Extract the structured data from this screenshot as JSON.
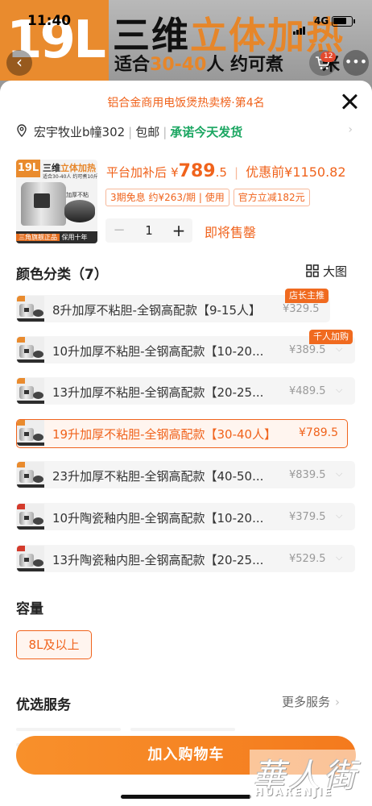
{
  "status_bar": {
    "time": "11:40",
    "network": "4G"
  },
  "background": {
    "badge": "19L",
    "title_black": "三维",
    "title_orange": "立体加热",
    "sub_pre": "适合",
    "sub_orange": "30-40",
    "sub_post": "人 约可煮",
    "sub_tail": "米",
    "cart_count": "12"
  },
  "sheet": {
    "rank": "铝合金商用电饭煲热卖榜·第4名",
    "address": "宏宇牧业b幢302",
    "shipping": "包邮",
    "promise": "承诺今天发货"
  },
  "product": {
    "thumb_badge": "19L",
    "thumb_title_black": "三维",
    "thumb_title_orange": "立体加热",
    "thumb_sub": "适合30-40人 约可煮10斤米",
    "thumb_tag": "加厚不粘",
    "thumb_foot_a": "三角旗舰正品",
    "thumb_foot_b": "保用十年",
    "price_label": "平台加补后",
    "price_symbol": "¥",
    "price_int": "789",
    "price_dec": ".5",
    "orig_label": "优惠前",
    "orig_price": "¥1150.82",
    "promos": [
      "3期免息 约¥263/期 | 使用",
      "官方立减182元"
    ],
    "quantity": "1",
    "selling_soon": "即将售罄"
  },
  "color_section": {
    "title": "颜色分类（7）",
    "view_toggle": "大图",
    "options": [
      {
        "label": "8升加厚不粘胆-全钢高配款【9-15人】",
        "price": "¥329.5",
        "tag": "店长主推"
      },
      {
        "label": "10升加厚不粘胆-全钢高配款【10-20...",
        "price": "¥389.5",
        "tag": "千人加购"
      },
      {
        "label": "13升加厚不粘胆-全钢高配款【20-25...",
        "price": "¥489.5",
        "tag": ""
      },
      {
        "label": "19升加厚不粘胆-全钢高配款【30-40人】",
        "price": "¥789.5",
        "tag": ""
      },
      {
        "label": "23升加厚不粘胆-全钢高配款【40-50...",
        "price": "¥839.5",
        "tag": ""
      },
      {
        "label": "10升陶瓷釉内胆-全钢高配款【10-20...",
        "price": "¥379.5",
        "tag": ""
      },
      {
        "label": "13升陶瓷釉内胆-全钢高配款【20-25...",
        "price": "¥529.5",
        "tag": ""
      }
    ]
  },
  "capacity_section": {
    "title": "容量",
    "option": "8L及以上"
  },
  "service_section": {
    "title": "优选服务",
    "more": "更多服务"
  },
  "add_to_cart": "加入购物车",
  "watermark": {
    "cn": "華人街",
    "en": "HUARENJIE"
  },
  "colors": {
    "accent": "#f0631c",
    "button": "#f8902b",
    "promise_green": "#1aa661"
  }
}
